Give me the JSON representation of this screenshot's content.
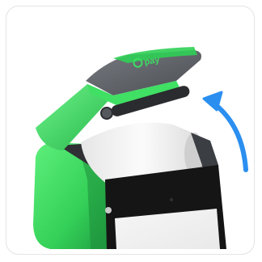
{
  "card": {
    "description_alt": "",
    "brand_logo_text": "pay"
  },
  "colors": {
    "card_border": "#e4e4e4",
    "device_green": "#3ddc62",
    "device_green_dark": "#23a845",
    "lid_grey": "#5a5d62",
    "paper_roll": "#f1f1f1",
    "screen_black": "#111111",
    "arrow_blue": "#2b8ff0"
  },
  "icons": {
    "arrow": "curved-arrow-up-left-icon",
    "logo": "pay-logo-icon"
  }
}
